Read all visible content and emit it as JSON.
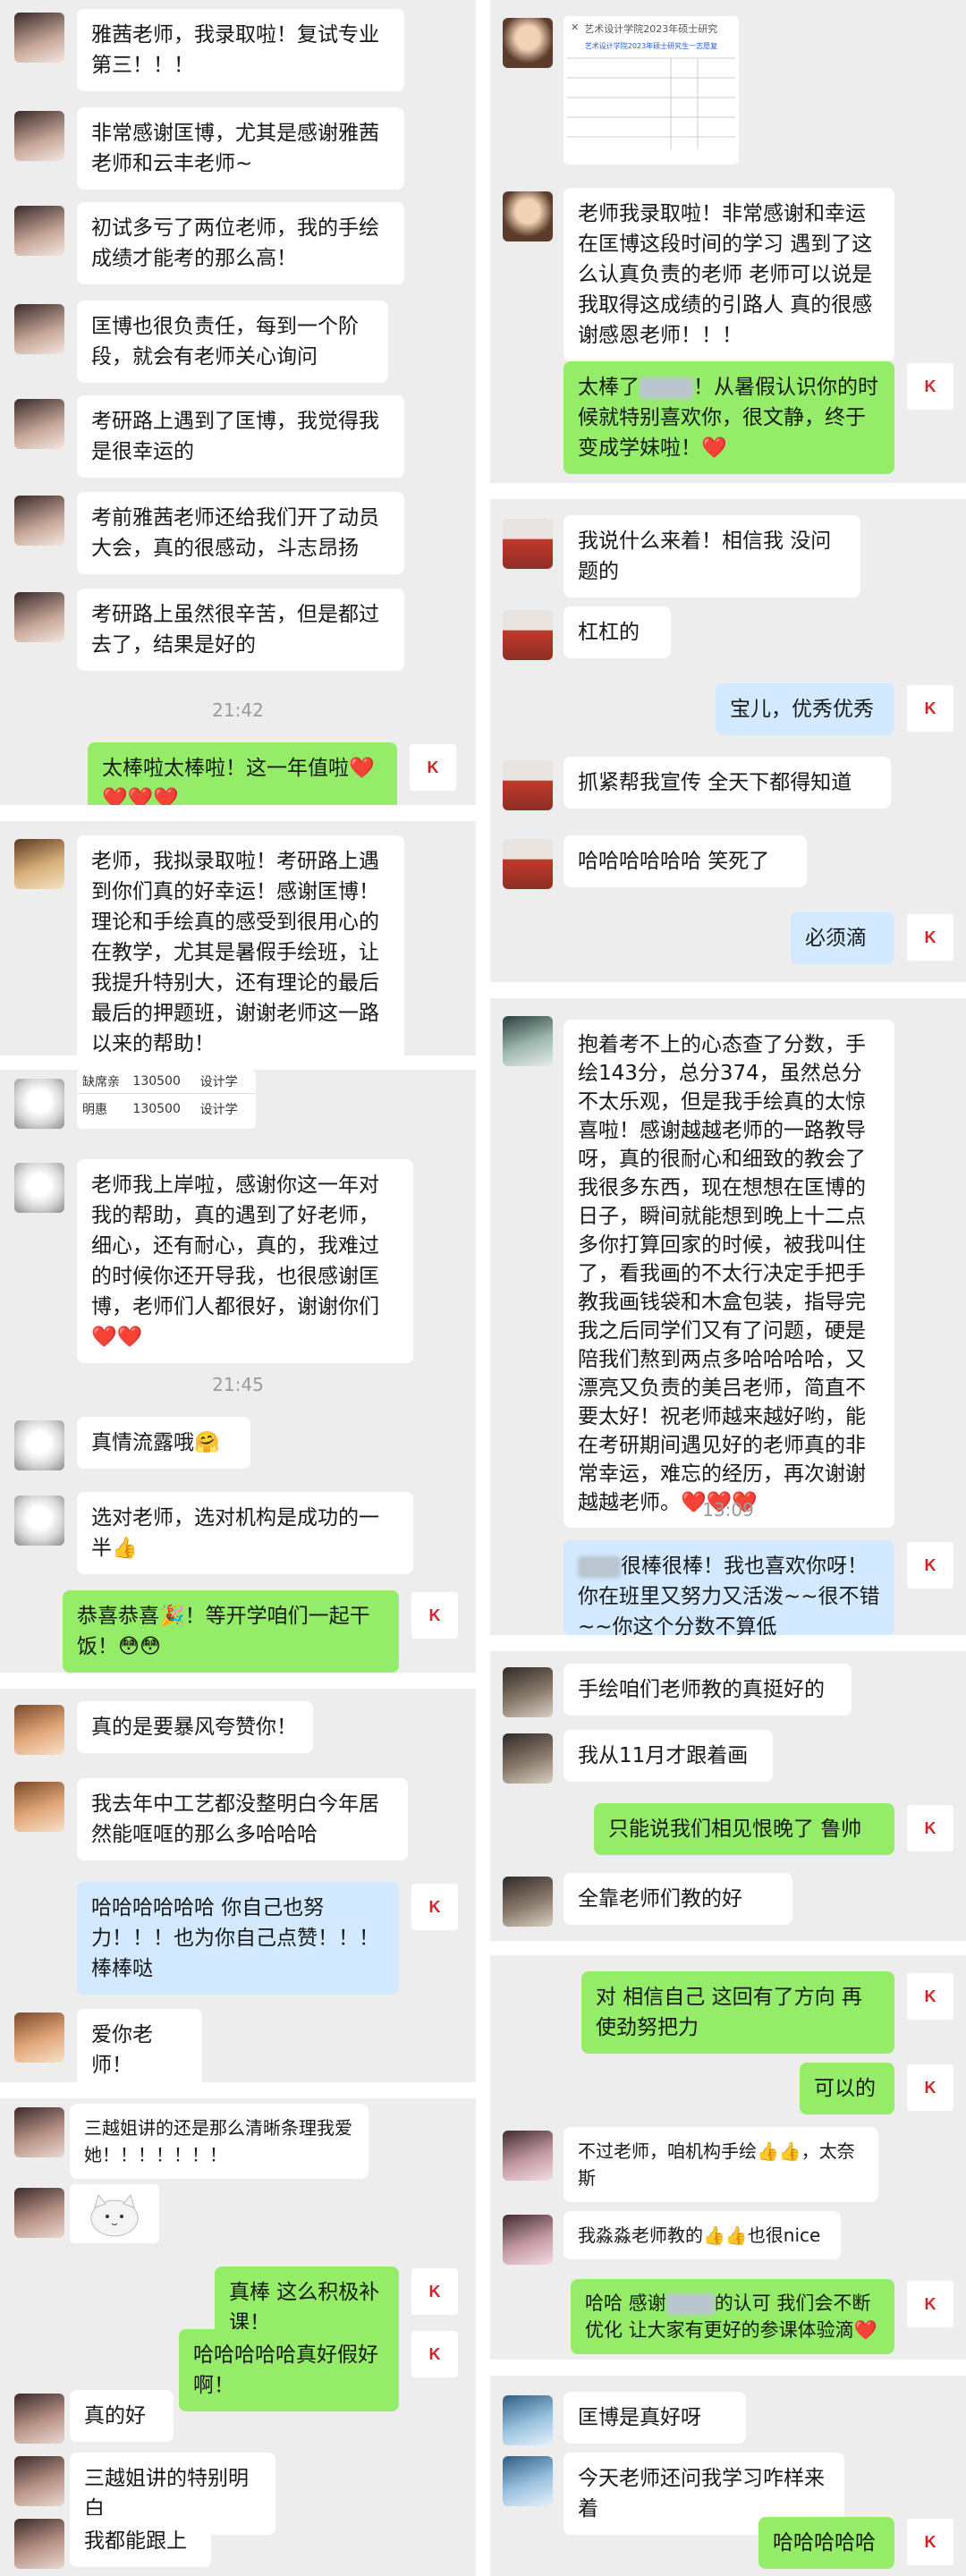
{
  "colors": {
    "in_bubble": "#ffffff",
    "out_bubble": "#95ec69",
    "out_bubble_blue": "#d3e9ff",
    "background": "#ededed",
    "timestamp": "#9b9b9b",
    "brand": "#d2232a"
  },
  "left": {
    "p1": {
      "messages": [
        "雅茜老师，我录取啦！复试专业第三！！！",
        "非常感谢匡博，尤其是感谢雅茜老师和云丰老师~",
        "初试多亏了两位老师，我的手绘成绩才能考的那么高！",
        "匡博也很负责任，每到一个阶段，就会有老师关心询问",
        "考研路上遇到了匡博，我觉得我是很幸运的",
        "考前雅茜老师还给我们开了动员大会，真的很感动，斗志昂扬",
        "考研路上虽然很辛苦，但是都过去了，结果是好的"
      ],
      "time": "21:42",
      "reply": "太棒啦太棒啦！这一年值啦❤️❤️❤️❤️"
    },
    "p2": {
      "message": "老师，我拟录取啦！考研路上遇到你们真的好幸运！感谢匡博！理论和手绘真的感受到很用心的在教学，尤其是暑假手绘班，让我提升特别大，还有理论的最后最后的押题班，谢谢老师这一路以来的帮助！"
    },
    "p3": {
      "table_rows": [
        [
          "缺席亲",
          "130500",
          "设计学"
        ],
        [
          "明惠",
          "130500",
          "设计学"
        ]
      ],
      "message": "老师我上岸啦，感谢你这一年对我的帮助，真的遇到了好老师，细心，还有耐心，真的，我难过的时候你还开导我，也很感谢匡博，老师们人都很好，谢谢你们❤️❤️",
      "time": "21:45",
      "msg2": "真情流露哦🤗",
      "msg3": "选对老师，选对机构是成功的一半👍",
      "reply": "恭喜恭喜🎉！等开学咱们一起干饭！😳😳"
    },
    "p4": {
      "msg1": "真的是要暴风夸赞你！",
      "msg2": "我去年中工艺都没整明白今年居然能哐哐的那么多哈哈哈",
      "reply": "哈哈哈哈哈哈 你自己也努力！！！也为你自己点赞！！！棒棒哒",
      "msg3": "爱你老师！"
    },
    "p5": {
      "msg1": "三越姐讲的还是那么清晰条理我爱她！！！！！！！",
      "reply1": "真棒 这么积极补课！",
      "reply2": "哈哈哈哈哈真好假好啊！",
      "msg2": "真的好",
      "msg3": "三越姐讲的特别明白",
      "msg4": "我都能跟上"
    }
  },
  "right": {
    "q1": {
      "doc_title": "艺术设计学院2023年硕士研究",
      "doc_subtitle": "艺术设计学院2023年硕士研究生一志愿复",
      "msg": "老师我录取啦！非常感谢和幸运在匡博这段时间的学习 遇到了这么认真负责的老师 老师可以说是我取得这成绩的引路人 真的很感谢感恩老师！！！",
      "reply_pre": "太棒了",
      "reply_post": "！从暑假认识你的时候就特别喜欢你，很文静，终于变成学妹啦！❤️"
    },
    "q2": {
      "msg1": "我说什么来着！相信我 没问题的",
      "msg2": "杠杠的",
      "reply1": "宝儿，优秀优秀",
      "msg3": "抓紧帮我宣传 全天下都得知道",
      "msg4": "哈哈哈哈哈哈 笑死了",
      "reply2": "必须滴"
    },
    "q3": {
      "msg": "抱着考不上的心态查了分数，手绘143分，总分374，虽然总分不太乐观，但是我手绘真的太惊喜啦！感谢越越老师的一路教导呀，真的很耐心和细致的教会了我很多东西，现在想想在匡博的日子，瞬间就能想到晚上十二点多你打算回家的时候，被我叫住了，看我画的不太行决定手把手教我画钱袋和木盒包装，指导完我之后同学们又有了问题，硬是陪我们熬到两点多哈哈哈哈，又漂亮又负责的美吕老师，简直不要太好！祝老师越来越好哟，能在考研期间遇见好的老师真的非常幸运，难忘的经历，再次谢谢越越老师。❤️❤️❤️",
      "time": "13:09",
      "reply_post": "很棒很棒！我也喜欢你呀！你在班里又努力又活泼~~很不错~~你这个分数不算低"
    },
    "q4": {
      "msg1": "手绘咱们老师教的真挺好的",
      "msg2": "我从11月才跟着画",
      "reply": "只能说我们相见恨晚了 鲁帅",
      "msg3": "全靠老师们教的好"
    },
    "q5": {
      "reply1": "对 相信自己 这回有了方向 再使劲努把力",
      "reply2": "可以的",
      "msg1": "不过老师，咱机构手绘👍👍，太奈斯",
      "msg2": "我淼淼老师教的👍👍也很nice",
      "reply3_pre": "哈哈 感谢",
      "reply3_post": "的认可 我们会不断优化 让大家有更好的参课体验滴❤️"
    },
    "q6": {
      "msg1": "匡博是真好呀",
      "msg2": "今天老师还问我学习咋样来着",
      "reply": "哈哈哈哈哈"
    }
  },
  "brand_logo_text": "K"
}
